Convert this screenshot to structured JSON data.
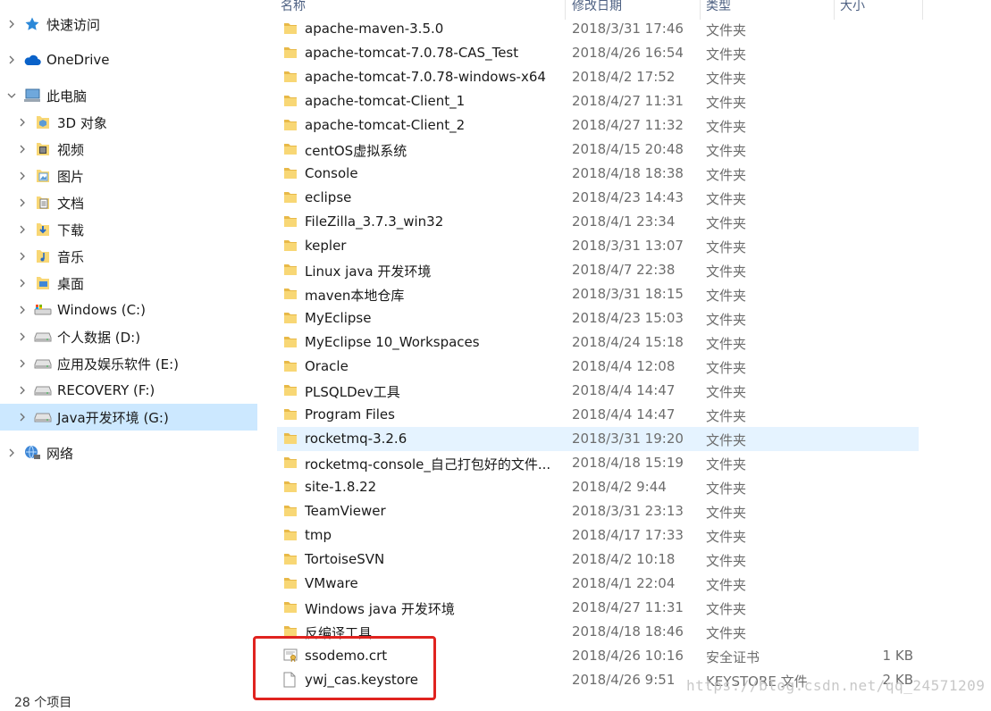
{
  "nav": {
    "items": [
      {
        "label": "快速访问",
        "icon": "star-icon",
        "level": 0,
        "expanded": false,
        "selected": false
      },
      {
        "label": "OneDrive",
        "icon": "cloud-icon",
        "level": 0,
        "expanded": false,
        "selected": false
      },
      {
        "label": "此电脑",
        "icon": "computer-icon",
        "level": 0,
        "expanded": true,
        "selected": false
      },
      {
        "label": "3D 对象",
        "icon": "3d-objects-icon",
        "level": 1,
        "expanded": false,
        "selected": false
      },
      {
        "label": "视频",
        "icon": "videos-icon",
        "level": 1,
        "expanded": false,
        "selected": false
      },
      {
        "label": "图片",
        "icon": "pictures-icon",
        "level": 1,
        "expanded": false,
        "selected": false
      },
      {
        "label": "文档",
        "icon": "documents-icon",
        "level": 1,
        "expanded": false,
        "selected": false
      },
      {
        "label": "下载",
        "icon": "downloads-icon",
        "level": 1,
        "expanded": false,
        "selected": false
      },
      {
        "label": "音乐",
        "icon": "music-icon",
        "level": 1,
        "expanded": false,
        "selected": false
      },
      {
        "label": "桌面",
        "icon": "desktop-icon",
        "level": 1,
        "expanded": false,
        "selected": false
      },
      {
        "label": "Windows (C:)",
        "icon": "system-drive-icon",
        "level": 1,
        "expanded": false,
        "selected": false
      },
      {
        "label": "个人数据 (D:)",
        "icon": "drive-icon",
        "level": 1,
        "expanded": false,
        "selected": false
      },
      {
        "label": "应用及娱乐软件 (E:)",
        "icon": "drive-icon",
        "level": 1,
        "expanded": false,
        "selected": false
      },
      {
        "label": "RECOVERY (F:)",
        "icon": "drive-icon",
        "level": 1,
        "expanded": false,
        "selected": false
      },
      {
        "label": "Java开发环境 (G:)",
        "icon": "drive-icon",
        "level": 1,
        "expanded": false,
        "selected": true
      },
      {
        "label": "网络",
        "icon": "network-icon",
        "level": 0,
        "expanded": false,
        "selected": false
      }
    ]
  },
  "status": {
    "item_count": "28 个项目"
  },
  "columns": {
    "name": "名称",
    "date": "修改日期",
    "type": "类型",
    "size": "大小"
  },
  "files": [
    {
      "name": "apache-maven-3.5.0",
      "date": "2018/3/31 17:46",
      "type": "文件夹",
      "size": "",
      "icon": "folder-icon"
    },
    {
      "name": "apache-tomcat-7.0.78-CAS_Test",
      "date": "2018/4/26 16:54",
      "type": "文件夹",
      "size": "",
      "icon": "folder-icon"
    },
    {
      "name": "apache-tomcat-7.0.78-windows-x64",
      "date": "2018/4/2 17:52",
      "type": "文件夹",
      "size": "",
      "icon": "folder-icon"
    },
    {
      "name": "apache-tomcat-Client_1",
      "date": "2018/4/27 11:31",
      "type": "文件夹",
      "size": "",
      "icon": "folder-icon"
    },
    {
      "name": "apache-tomcat-Client_2",
      "date": "2018/4/27 11:32",
      "type": "文件夹",
      "size": "",
      "icon": "folder-icon"
    },
    {
      "name": "centOS虚拟系统",
      "date": "2018/4/15 20:48",
      "type": "文件夹",
      "size": "",
      "icon": "folder-icon"
    },
    {
      "name": "Console",
      "date": "2018/4/18 18:38",
      "type": "文件夹",
      "size": "",
      "icon": "folder-icon"
    },
    {
      "name": "eclipse",
      "date": "2018/4/23 14:43",
      "type": "文件夹",
      "size": "",
      "icon": "folder-icon"
    },
    {
      "name": "FileZilla_3.7.3_win32",
      "date": "2018/4/1 23:34",
      "type": "文件夹",
      "size": "",
      "icon": "folder-icon"
    },
    {
      "name": "kepler",
      "date": "2018/3/31 13:07",
      "type": "文件夹",
      "size": "",
      "icon": "folder-icon"
    },
    {
      "name": "Linux java 开发环境",
      "date": "2018/4/7 22:38",
      "type": "文件夹",
      "size": "",
      "icon": "folder-icon"
    },
    {
      "name": "maven本地仓库",
      "date": "2018/3/31 18:15",
      "type": "文件夹",
      "size": "",
      "icon": "folder-icon"
    },
    {
      "name": "MyEclipse",
      "date": "2018/4/23 15:03",
      "type": "文件夹",
      "size": "",
      "icon": "folder-icon"
    },
    {
      "name": "MyEclipse 10_Workspaces",
      "date": "2018/4/24 15:18",
      "type": "文件夹",
      "size": "",
      "icon": "folder-icon"
    },
    {
      "name": "Oracle",
      "date": "2018/4/4 12:08",
      "type": "文件夹",
      "size": "",
      "icon": "folder-icon"
    },
    {
      "name": "PLSQLDev工具",
      "date": "2018/4/4 14:47",
      "type": "文件夹",
      "size": "",
      "icon": "folder-icon"
    },
    {
      "name": "Program Files",
      "date": "2018/4/4 14:47",
      "type": "文件夹",
      "size": "",
      "icon": "folder-icon"
    },
    {
      "name": "rocketmq-3.2.6",
      "date": "2018/3/31 19:20",
      "type": "文件夹",
      "size": "",
      "icon": "folder-icon",
      "hover": true
    },
    {
      "name": "rocketmq-console_自己打包好的文件...",
      "date": "2018/4/18 15:19",
      "type": "文件夹",
      "size": "",
      "icon": "folder-icon"
    },
    {
      "name": "site-1.8.22",
      "date": "2018/4/2 9:44",
      "type": "文件夹",
      "size": "",
      "icon": "folder-icon"
    },
    {
      "name": "TeamViewer",
      "date": "2018/3/31 23:13",
      "type": "文件夹",
      "size": "",
      "icon": "folder-icon"
    },
    {
      "name": "tmp",
      "date": "2018/4/17 17:33",
      "type": "文件夹",
      "size": "",
      "icon": "folder-icon"
    },
    {
      "name": "TortoiseSVN",
      "date": "2018/4/2 10:18",
      "type": "文件夹",
      "size": "",
      "icon": "folder-icon"
    },
    {
      "name": "VMware",
      "date": "2018/4/1 22:04",
      "type": "文件夹",
      "size": "",
      "icon": "folder-icon"
    },
    {
      "name": "Windows java 开发环境",
      "date": "2018/4/27 11:31",
      "type": "文件夹",
      "size": "",
      "icon": "folder-icon"
    },
    {
      "name": "反编译工具",
      "date": "2018/4/18 18:46",
      "type": "文件夹",
      "size": "",
      "icon": "folder-icon"
    },
    {
      "name": "ssodemo.crt",
      "date": "2018/4/26 10:16",
      "type": "安全证书",
      "size": "1 KB",
      "icon": "certificate-file-icon"
    },
    {
      "name": "ywj_cas.keystore",
      "date": "2018/4/26 9:51",
      "type": "KEYSTORE 文件",
      "size": "2 KB",
      "icon": "file-icon"
    }
  ],
  "watermark": "https://blog.csdn.net/qq_24571209",
  "colors": {
    "selection": "#cce8ff",
    "hover": "#e5f3ff",
    "highlight_box": "#e0231f",
    "folder": "#f8d775"
  }
}
